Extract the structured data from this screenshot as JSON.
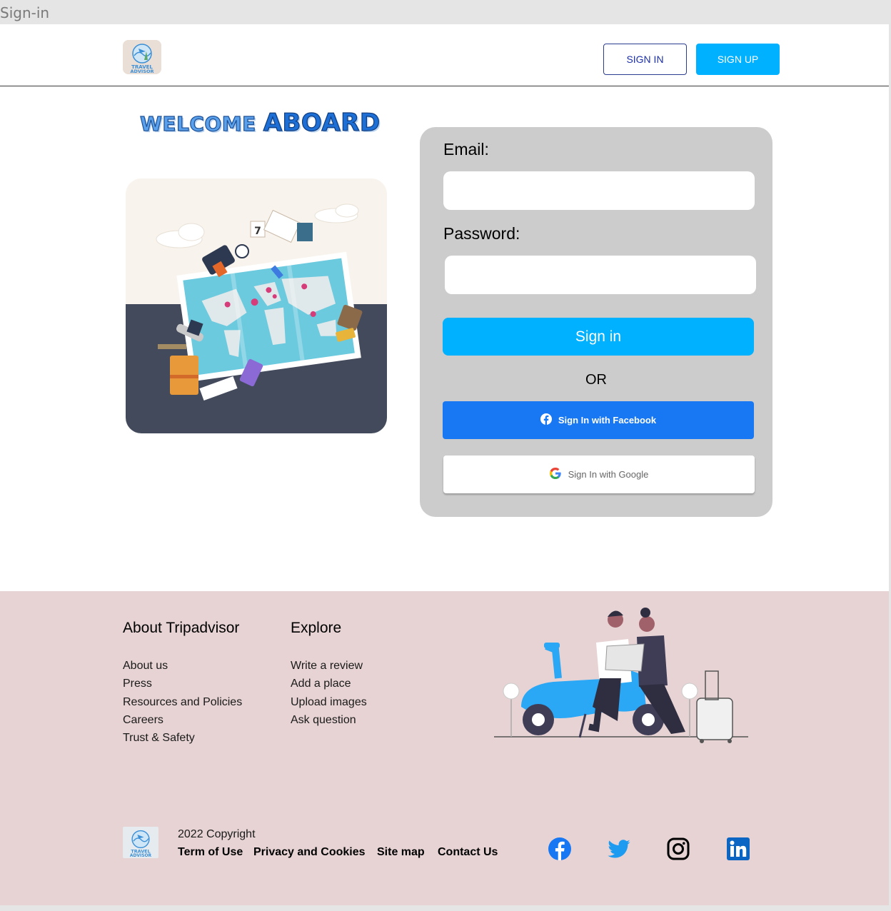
{
  "frame_title": "Sign-in",
  "header": {
    "logo_text": [
      "TRAVEL",
      "ADVISOR"
    ],
    "signin_label": "SIGN IN",
    "signup_label": "SIGN UP"
  },
  "welcome": {
    "word1": "WELCOME",
    "word2": "ABOARD"
  },
  "form": {
    "email_label": "Email:",
    "email_value": "",
    "password_label": "Password:",
    "password_value": "",
    "signin_label": "Sign in",
    "or_label": "OR",
    "facebook_label": "Sign In with Facebook",
    "google_label": "Sign In with Google"
  },
  "footer": {
    "about_title": "About Tripadvisor",
    "about_links": [
      "About us",
      "Press",
      "Resources and Policies",
      "Careers",
      "Trust & Safety"
    ],
    "explore_title": "Explore",
    "explore_links": [
      "Write a review",
      "Add a place",
      "Upload images",
      "Ask question"
    ],
    "copyright": "2022 Copyright",
    "bottom_links": [
      "Term of Use",
      "Privacy and Cookies",
      "Site map",
      "Contact Us"
    ],
    "social_icons": [
      "facebook-icon",
      "twitter-icon",
      "instagram-icon",
      "linkedin-icon"
    ]
  },
  "colors": {
    "accent": "#00b1ff",
    "facebook": "#1877f2",
    "card": "#cccccc",
    "footer_bg": "#e7d3d4",
    "hero_dark": "#434a5c"
  }
}
